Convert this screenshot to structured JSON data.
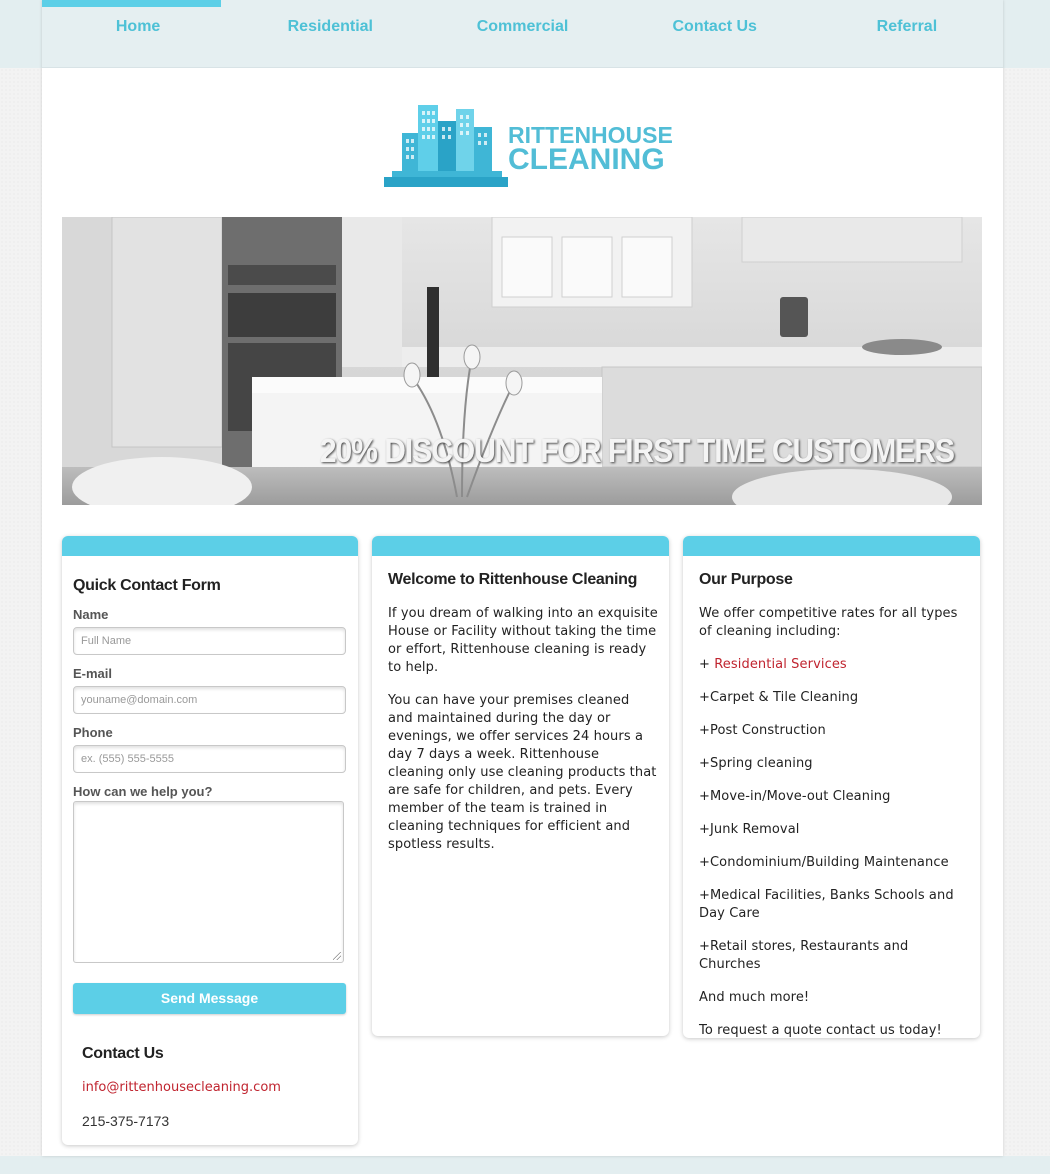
{
  "nav": {
    "items": [
      {
        "label": "Home",
        "active": true
      },
      {
        "label": "Residential",
        "active": false
      },
      {
        "label": "Commercial",
        "active": false
      },
      {
        "label": "Contact Us",
        "active": false
      },
      {
        "label": "Referral",
        "active": false
      }
    ]
  },
  "logo": {
    "line1": "RITTENHOUSE",
    "line2": "CLEANING"
  },
  "hero": {
    "caption": "20% DISCOUNT FOR FIRST TIME CUSTOMERS"
  },
  "form": {
    "title": "Quick Contact Form",
    "name_label": "Name",
    "name_placeholder": "Full Name",
    "email_label": "E-mail",
    "email_placeholder": "youname@domain.com",
    "phone_label": "Phone",
    "phone_placeholder": "ex. (555) 555-5555",
    "help_label": "How can we help you?",
    "submit_label": "Send Message"
  },
  "contact": {
    "title": "Contact Us",
    "email": "info@rittenhousecleaning.com",
    "phone": "215-375-7173"
  },
  "welcome": {
    "title": "Welcome to Rittenhouse Cleaning",
    "para1": "If you dream of walking into an exquisite House or Facility without taking the time or effort, Rittenhouse cleaning is ready to help.",
    "para2": "You can have your premises cleaned and maintained during the day or evenings, we offer services 24 hours a day 7 days a week. Rittenhouse cleaning only use cleaning products that are safe for children, and pets. Every member of the team is trained in cleaning techniques for efficient and spotless results."
  },
  "purpose": {
    "title": "Our Purpose",
    "intro": "We offer competitive rates for all types of cleaning including:",
    "link_prefix": "+ ",
    "link_label": "Residential Services",
    "items": [
      "+Carpet & Tile Cleaning",
      "+Post Construction",
      "+Spring cleaning",
      "+Move-in/Move-out Cleaning",
      "+Junk Removal",
      "+Condominium/Building Maintenance",
      "+Medical Facilities, Banks Schools and Day Care",
      "+Retail stores, Restaurants and Churches"
    ],
    "more": "And much more!",
    "cta": "To request a quote contact us today!"
  },
  "colors": {
    "accent": "#5ccfe7",
    "nav_text": "#4ec1d6",
    "link_red": "#c0242f",
    "nav_bg": "#e5eff1"
  }
}
